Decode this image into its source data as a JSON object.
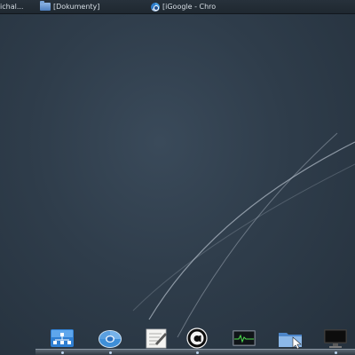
{
  "taskbar": {
    "tasks": [
      {
        "label": "ichal...",
        "icon": "none"
      },
      {
        "label": "[Dokumenty]",
        "icon": "folder-icon"
      },
      {
        "label": "[iGoogle - Chro",
        "icon": "chrome-icon"
      }
    ]
  },
  "dock": {
    "items": [
      {
        "name": "network-manager-icon"
      },
      {
        "name": "chrome-icon"
      },
      {
        "name": "text-editor-icon"
      },
      {
        "name": "amarok-icon"
      },
      {
        "name": "system-monitor-icon"
      },
      {
        "name": "file-manager-icon"
      },
      {
        "name": "display-settings-icon"
      }
    ]
  },
  "colors": {
    "desktop_background": "#2f3d4b",
    "taskbar_background": "#222b34",
    "taskbar_text": "#d6dde4"
  }
}
